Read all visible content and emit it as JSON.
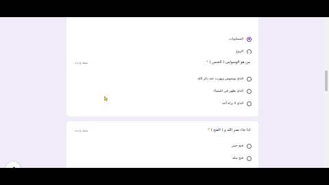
{
  "accent_color": "#673ab7",
  "required_color": "#d93025",
  "card1": {
    "options": [
      {
        "label": "السماويات",
        "selected": true
      },
      {
        "label": "الزوج",
        "selected": false
      }
    ]
  },
  "card2": {
    "title": "من هو الوسواس ( الخنس )",
    "required_mark": "*",
    "points": "نقطة واحدة",
    "options": [
      {
        "label": "الذي يوسوس ويهرب عند ذكر الله",
        "selected": false
      },
      {
        "label": "الذي يظهر في السماء",
        "selected": false
      },
      {
        "label": "الذي لا يراه أحد",
        "selected": false
      }
    ]
  },
  "card3": {
    "title": "إذا جاء نصر الله و ( الفتح )",
    "required_mark": "*",
    "points": "نقطة واحدة",
    "options": [
      {
        "label": "فتح خيبر",
        "selected": false
      },
      {
        "label": "فتح مكة",
        "selected": false
      }
    ]
  },
  "icons": {
    "edit": "pencil-icon",
    "fullscreen": "fullscreen-icon",
    "cursor": "mouse-cursor-icon"
  }
}
